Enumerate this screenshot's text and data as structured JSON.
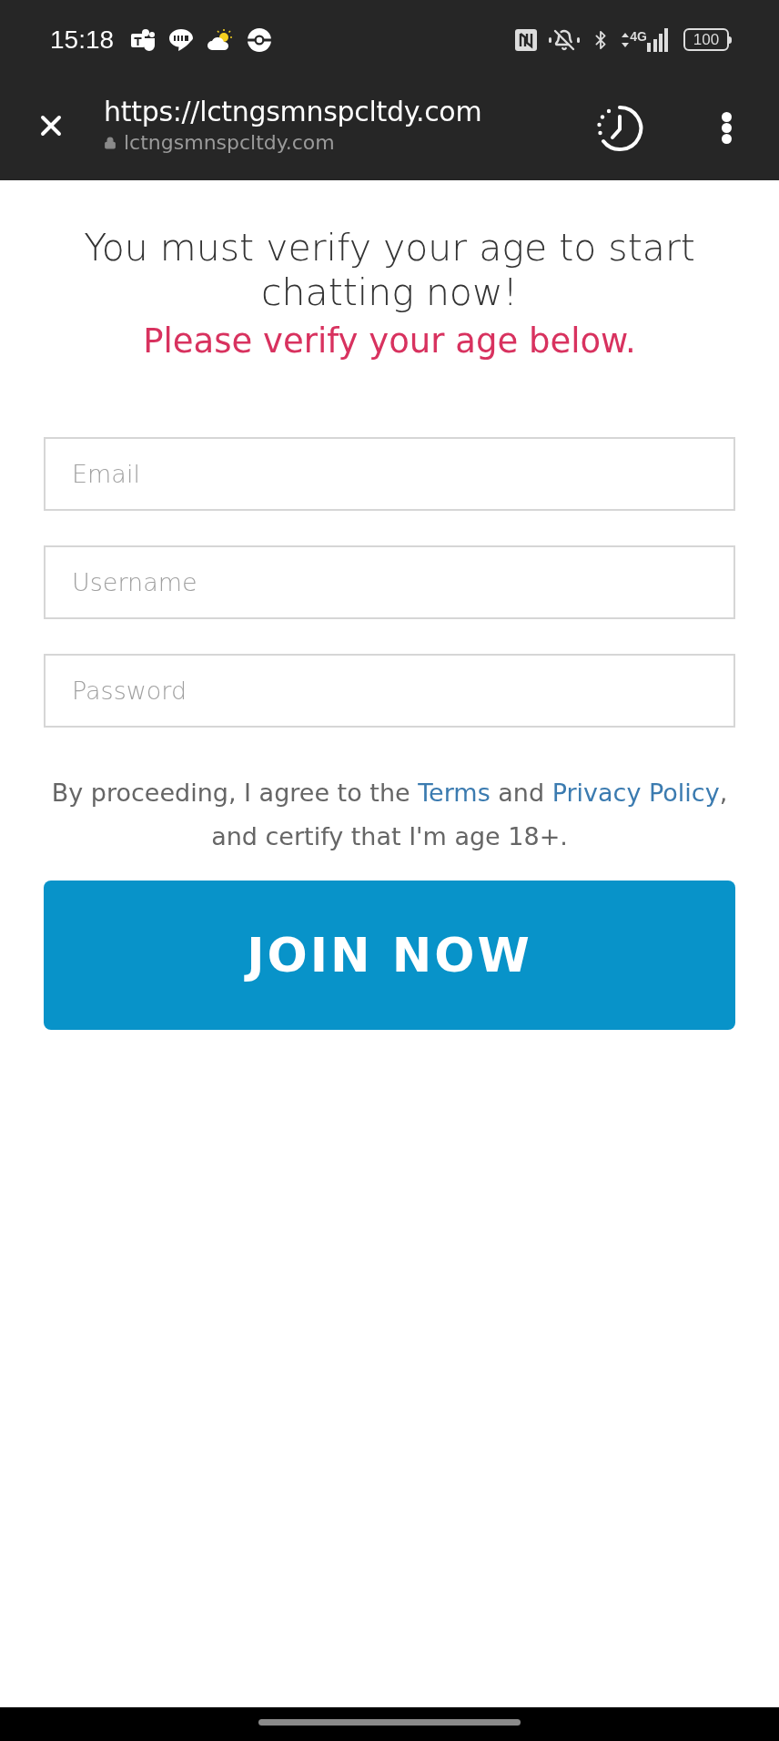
{
  "status_bar": {
    "time": "15:18",
    "network": "4G",
    "battery": "100"
  },
  "browser_bar": {
    "title": "https://lctngsmnspcltdy.com",
    "domain": "lctngsmnspcltdy.com"
  },
  "heading": "You must verify your age to start chatting now!",
  "subheading": "Please verify your age below.",
  "fields": [
    {
      "placeholder": "Email"
    },
    {
      "placeholder": "Username"
    },
    {
      "placeholder": "Password"
    }
  ],
  "consent": [
    {
      "kind": "text",
      "text": "By proceeding, I agree to the "
    },
    {
      "kind": "link",
      "text": "Terms"
    },
    {
      "kind": "text",
      "text": " and "
    },
    {
      "kind": "link",
      "text": "Privacy Policy"
    },
    {
      "kind": "text",
      "text": ", and certify that I'm age 18+."
    }
  ],
  "button": "JOIN NOW"
}
